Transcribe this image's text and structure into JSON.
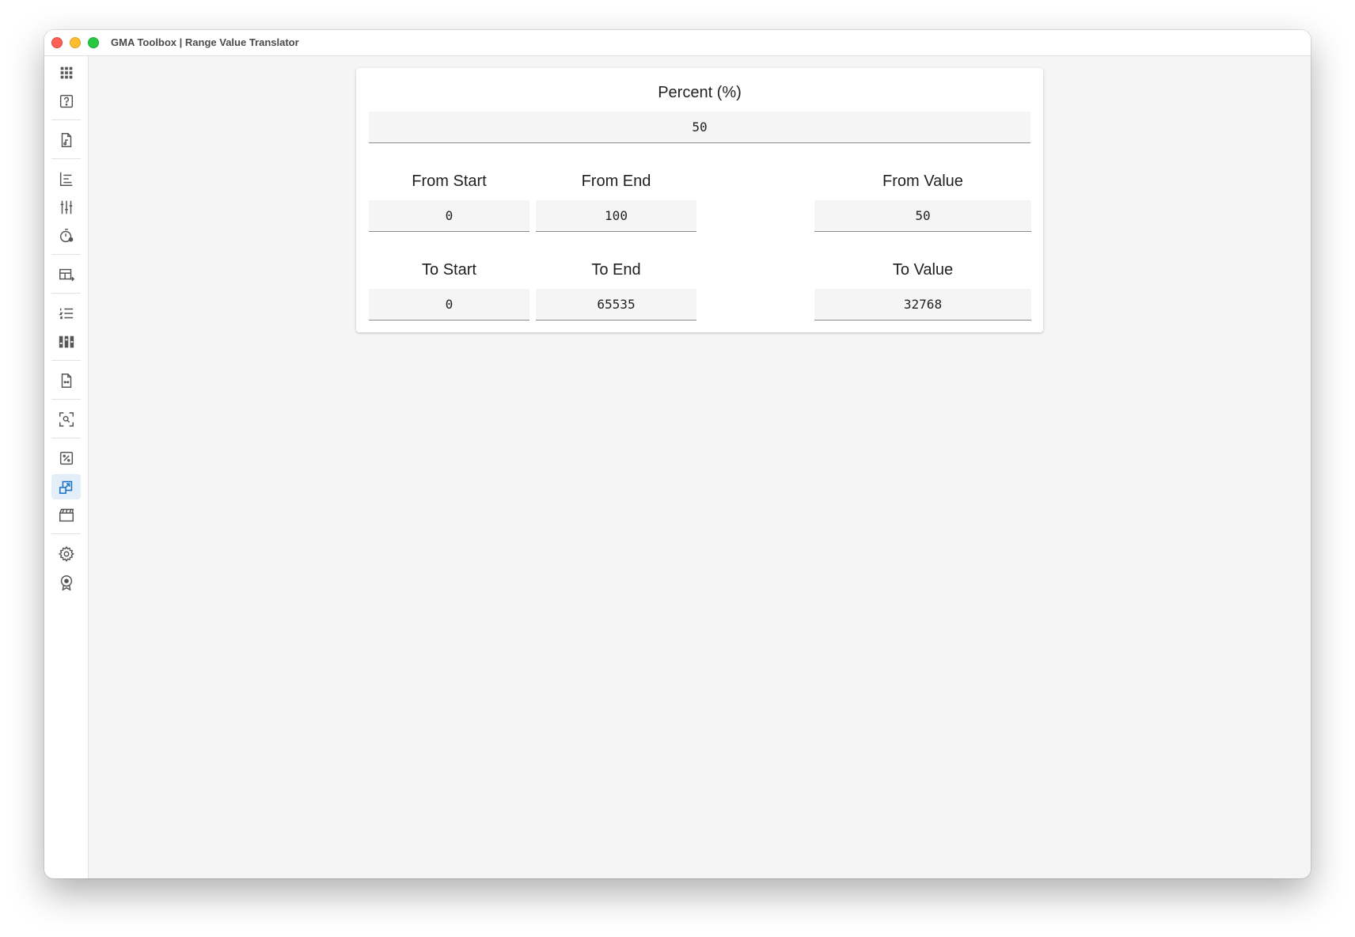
{
  "window": {
    "title": "GMA Toolbox | Range Value Translator"
  },
  "sidebar": {
    "items": [
      {
        "icon": "apps-grid-icon",
        "active": false
      },
      {
        "icon": "help-icon",
        "active": false
      },
      {
        "icon": "audio-file-icon",
        "active": false
      },
      {
        "icon": "align-chart-icon",
        "active": false
      },
      {
        "icon": "sliders-icon",
        "active": false
      },
      {
        "icon": "timer-icon",
        "active": false
      },
      {
        "icon": "table-export-icon",
        "active": false
      },
      {
        "icon": "numbered-list-icon",
        "active": false
      },
      {
        "icon": "fader-bank-icon",
        "active": false
      },
      {
        "icon": "file-convert-icon",
        "active": false
      },
      {
        "icon": "scan-search-icon",
        "active": false
      },
      {
        "icon": "percent-box-icon",
        "active": false
      },
      {
        "icon": "range-translate-icon",
        "active": true
      },
      {
        "icon": "clapperboard-icon",
        "active": false
      },
      {
        "icon": "settings-gear-icon",
        "active": false
      },
      {
        "icon": "award-badge-icon",
        "active": false
      }
    ]
  },
  "colors": {
    "accent": "#1a73c8",
    "icon": "#555555",
    "active_bg": "#e4eef8"
  },
  "form": {
    "percent": {
      "label": "Percent (%)",
      "value": "50"
    },
    "from_start": {
      "label": "From Start",
      "value": "0"
    },
    "from_end": {
      "label": "From End",
      "value": "100"
    },
    "from_value": {
      "label": "From Value",
      "value": "50"
    },
    "to_start": {
      "label": "To Start",
      "value": "0"
    },
    "to_end": {
      "label": "To End",
      "value": "65535"
    },
    "to_value": {
      "label": "To Value",
      "value": "32768"
    }
  }
}
